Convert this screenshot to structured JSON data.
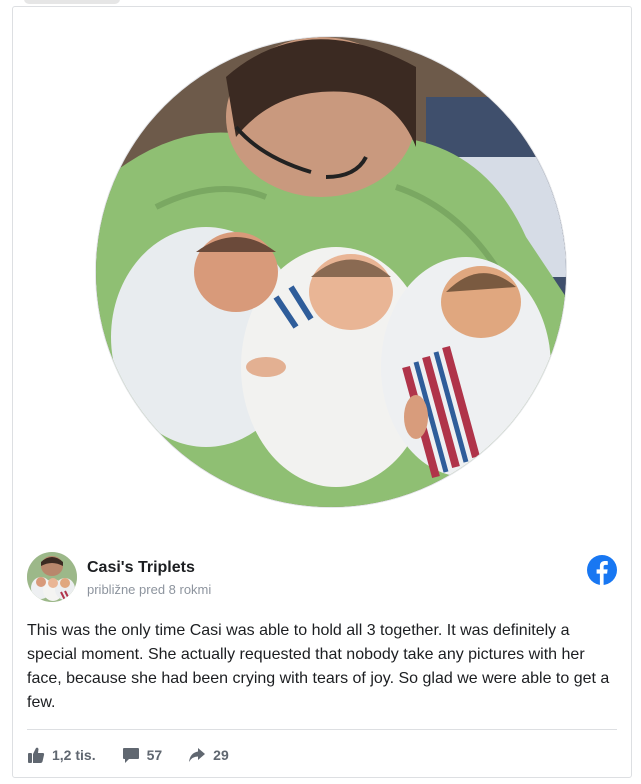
{
  "post": {
    "page_name": "Casi's Triplets",
    "timestamp": "približne pred 8 rokmi",
    "text": "This was the only time Casi was able to hold all 3 together. It was definitely a special moment. She actually requested that nobody take any pictures with her face, because she had been crying with tears of joy. So glad we were able to get a few."
  },
  "stats": {
    "likes": "1,2 tis.",
    "comments": "57",
    "shares": "29"
  },
  "icons": {
    "brand": "facebook-icon",
    "like": "thumbs-up-icon",
    "comment": "comment-icon",
    "share": "share-arrow-icon"
  },
  "colors": {
    "facebook_blue": "#1877f2",
    "text": "#1c1e21",
    "muted": "#8d949e",
    "action": "#606770"
  }
}
